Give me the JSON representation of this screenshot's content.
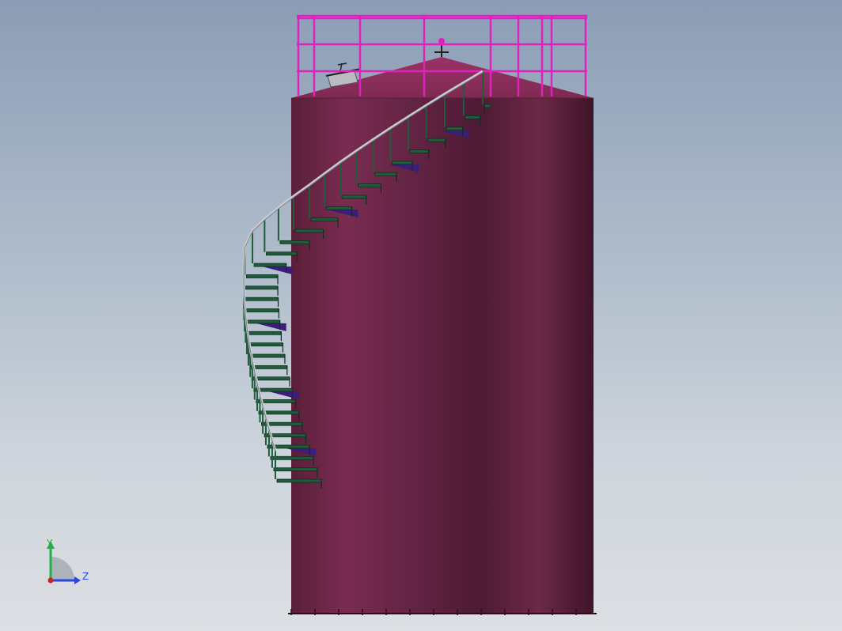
{
  "viewport": {
    "background_top": "#8b9db5",
    "background_bottom": "#dcdfe3"
  },
  "model": {
    "tank_color": "#6e2849",
    "roof_color": "#8a2d58",
    "railing_color": "#e020c0",
    "stair_color": "#1f5c3c",
    "stair_bracket_color": "#3d1d7a",
    "handrail_color": "#c8cdd2"
  },
  "triad": {
    "y_label": "Y",
    "z_label": "Z",
    "y_color": "#22b04a",
    "z_color": "#2848d8",
    "x_color": "#d02020"
  }
}
